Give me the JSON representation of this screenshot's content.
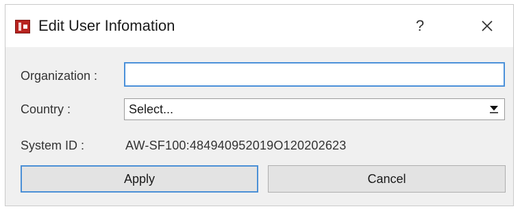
{
  "window": {
    "title": "Edit User Infomation",
    "help_label": "?",
    "icon": "app-icon",
    "close_icon": "close-icon"
  },
  "form": {
    "organization_label": "Organization :",
    "organization_value": "",
    "country_label": "Country :",
    "country_value": "Select...",
    "system_id_label": "System ID :",
    "system_id_value": "AW-SF100:484940952019O120202623"
  },
  "buttons": {
    "apply_label": "Apply",
    "cancel_label": "Cancel"
  },
  "colors": {
    "focus_border": "#4a90d9",
    "dialog_bg": "#f0f0f0",
    "titlebar_bg": "#ffffff",
    "icon_red": "#b8231f"
  }
}
